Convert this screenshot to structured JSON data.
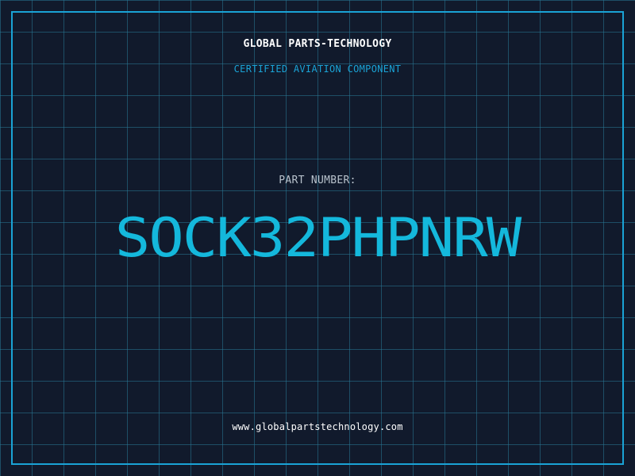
{
  "header": {
    "company": "GLOBAL PARTS-TECHNOLOGY",
    "subtitle": "CERTIFIED AVIATION COMPONENT"
  },
  "part": {
    "label": "PART NUMBER:",
    "number": "SOCK32PHPNRW"
  },
  "footer": {
    "website": "www.globalpartstechnology.com"
  },
  "colors": {
    "background": "#111a2c",
    "grid": "#287896",
    "accent": "#1aa3d6",
    "part_number": "#14b8dc",
    "text": "#ffffff",
    "muted": "#b8c2cc"
  }
}
